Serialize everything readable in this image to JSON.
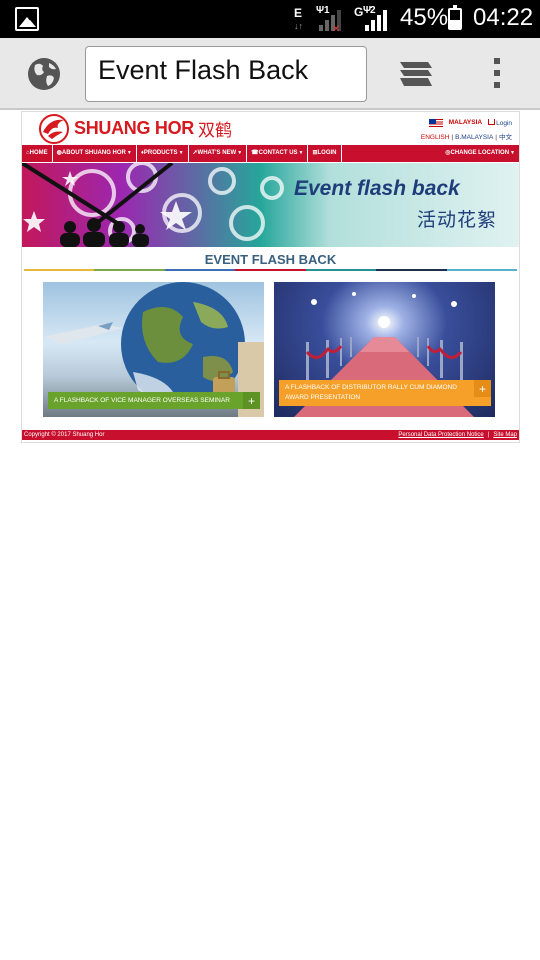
{
  "status_bar": {
    "network_labels": [
      "E",
      "1",
      "G",
      "2"
    ],
    "battery": "45%",
    "battery_level": 0.45,
    "time": "04:22"
  },
  "browser": {
    "url_text": "Event Flash Back",
    "icons": [
      "globe-icon",
      "tabs-icon",
      "overflow-menu-icon"
    ]
  },
  "site": {
    "brand": "SHUANG HOR",
    "brand_cn": "双鹤",
    "country": "MALAYSIA",
    "login": "Login",
    "lang_english": "ENGLISH",
    "lang_bm": "B.MALAYSIA",
    "lang_cn": "中文",
    "nav": [
      {
        "label": "HOME",
        "has_menu": false
      },
      {
        "label": "ABOUT SHUANG HOR",
        "has_menu": true
      },
      {
        "label": "PRODUCTS",
        "has_menu": true
      },
      {
        "label": "WHAT'S NEW",
        "has_menu": true
      },
      {
        "label": "CONTACT US",
        "has_menu": true
      },
      {
        "label": "LOGIN",
        "has_menu": false
      },
      {
        "label": "CHANGE LOCATION",
        "has_menu": true
      }
    ],
    "banner": {
      "title_en": "Event flash back",
      "title_cn": "活动花絮"
    },
    "section_title": "EVENT FLASH BACK",
    "cards": [
      {
        "caption": "A FLASHBACK OF VICE MANAGER OVERSEAS SEMINAR",
        "plus": "+",
        "accent": "#6aa32c"
      },
      {
        "caption": "A FLASHBACK OF DISTRIBUTOR RALLY CUM DIAMOND AWARD PRESENTATION",
        "plus": "+",
        "accent": "#f6a02a"
      }
    ],
    "footer": {
      "copyright": "Copyright © 2017 Shuang Hor",
      "privacy": "Personal Data Protection Notice",
      "separator": "|",
      "sitemap": "Site Map"
    },
    "colors": {
      "brand_red": "#c8102e",
      "title_blue": "#3a6080"
    }
  }
}
